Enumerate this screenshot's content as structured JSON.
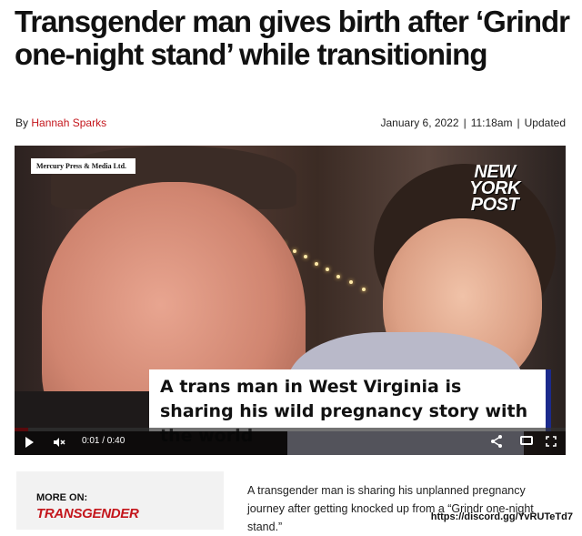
{
  "article": {
    "headline": "Transgender man gives birth after ‘Grindr one-night stand’ while transitioning",
    "byline_prefix": "By",
    "author": "Hannah Sparks",
    "date": "January 6, 2022",
    "time": "11:18am",
    "updated_label": "Updated"
  },
  "video": {
    "credit": "Mercury Press & Media Ltd.",
    "logo": [
      "NEW",
      "YORK",
      "POST"
    ],
    "caption": "A trans man in West Virginia is sharing his wild pregnancy story with the world",
    "time_display": "0:01 / 0:40",
    "progress_fraction": 0.025
  },
  "more_on": {
    "label": "MORE ON:",
    "topic": "TRANSGENDER"
  },
  "summary": "A transgender man is sharing his unplanned pregnancy journey after getting knocked up from a “Grindr one-night stand.”",
  "watermark": "https://discord.gg/YvRUTeTd7",
  "colors": {
    "accent": "#c4161c",
    "caption_bar": "#1b2a8c"
  },
  "icons": [
    "play-icon",
    "mute-icon",
    "share-icon",
    "captions-icon",
    "fullscreen-icon"
  ]
}
